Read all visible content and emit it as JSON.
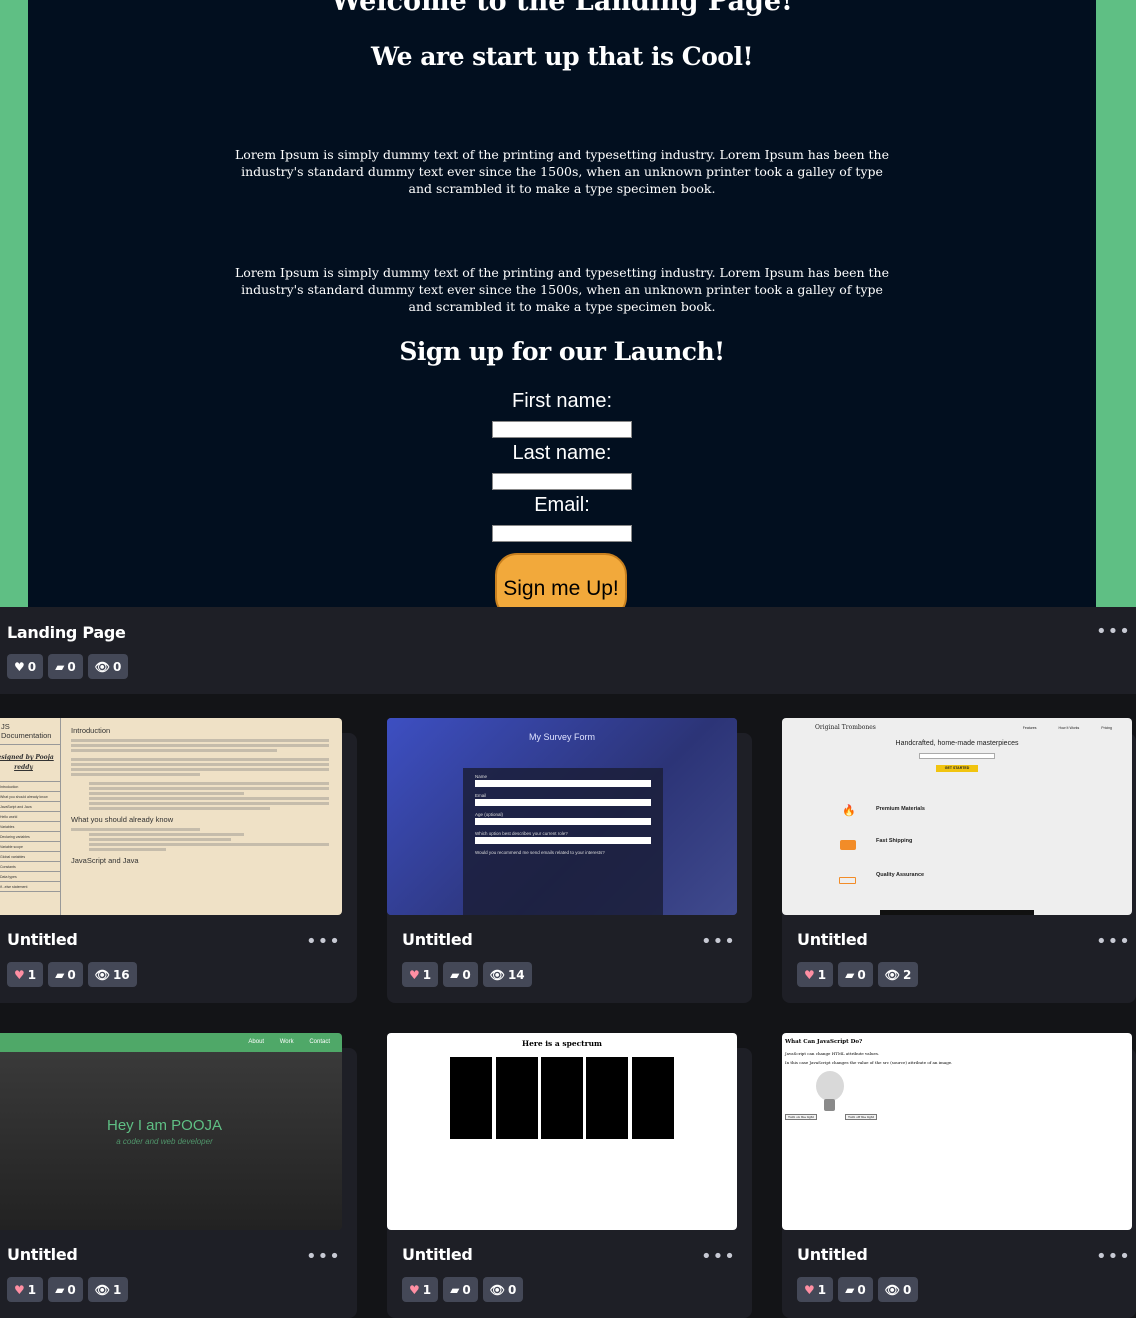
{
  "feature": {
    "welcome": "Welcome to the Landing Page!",
    "tagline": "We are start up that is Cool!",
    "lorem1": "Lorem Ipsum is simply dummy text of the printing and typesetting industry. Lorem Ipsum has been the industry's standard dummy text ever since the 1500s, when an unknown printer took a galley of type and scrambled it to make a type specimen book.",
    "lorem2": "Lorem Ipsum is simply dummy text of the printing and typesetting industry. Lorem Ipsum has been the industry's standard dummy text ever since the 1500s, when an unknown printer took a galley of type and scrambled it to make a type specimen book.",
    "signup_heading": "Sign up for our Launch!",
    "first_name_label": "First name:",
    "last_name_label": "Last name:",
    "email_label": "Email:",
    "signup_button": "Sign me Up!",
    "title": "Landing Page",
    "likes": "0",
    "comments": "0",
    "views": "0"
  },
  "cards": [
    {
      "title": "Untitled",
      "likes": "1",
      "comments": "0",
      "views": "16",
      "thumb": {
        "nav_title": "JS Documentation",
        "nav_sub": "designed by Pooja reddy",
        "nav_items": [
          "Introduction",
          "What you should already know",
          "JavaScript and Java",
          "Hello world",
          "Variables",
          "Declaring variables",
          "Variable scope",
          "Global variables",
          "Constants",
          "Data types",
          "if...else statement"
        ],
        "heading1": "Introduction",
        "heading2": "What you should already know",
        "heading3": "JavaScript and Java"
      }
    },
    {
      "title": "Untitled",
      "likes": "1",
      "comments": "0",
      "views": "14",
      "thumb": {
        "heading": "My Survey Form",
        "fields": [
          "Name",
          "Email",
          "Age (optional)",
          "Which option best describes your current role?",
          "Would you recommend me send emails related to your interests?"
        ]
      }
    },
    {
      "title": "Untitled",
      "likes": "1",
      "comments": "0",
      "views": "2",
      "thumb": {
        "brand": "Original Trombones",
        "nav": [
          "Features",
          "How It Works",
          "Pricing"
        ],
        "headline": "Handcrafted, home-made masterpieces",
        "cta": "GET STARTED",
        "features": [
          "Premium Materials",
          "Fast Shipping",
          "Quality Assurance"
        ]
      }
    },
    {
      "title": "Untitled",
      "likes": "1",
      "comments": "0",
      "views": "1",
      "thumb": {
        "nav": [
          "About",
          "Work",
          "Contact"
        ],
        "name": "Hey I am POOJA",
        "sub": "a coder and web developer"
      }
    },
    {
      "title": "Untitled",
      "likes": "1",
      "comments": "0",
      "views": "0",
      "thumb": {
        "heading": "Here is a spectrum"
      }
    },
    {
      "title": "Untitled",
      "likes": "1",
      "comments": "0",
      "views": "0",
      "thumb": {
        "heading": "What Can JavaScript Do?",
        "line1": "JavaScript can change HTML attribute values.",
        "line2": "In this case JavaScript changes the value of the src (source) attribute of an image.",
        "btn_on": "Turn on the light",
        "btn_off": "Turn off the light"
      }
    }
  ]
}
